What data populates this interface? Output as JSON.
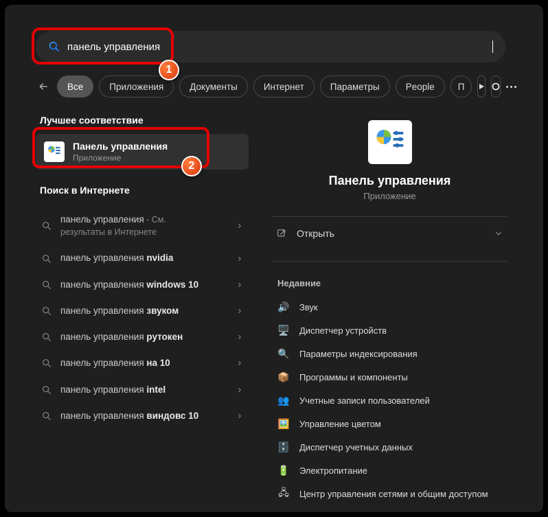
{
  "search": {
    "value": "панель управления"
  },
  "filters": {
    "back_icon": "arrow-left",
    "pills": [
      "Все",
      "Приложения",
      "Документы",
      "Интернет",
      "Параметры",
      "People",
      "П"
    ],
    "active_index": 0,
    "play_icon": "play",
    "circle_icon": "circle",
    "overflow_icon": "more"
  },
  "left": {
    "best_header": "Лучшее соответствие",
    "best": {
      "title": "Панель управления",
      "subtitle": "Приложение"
    },
    "web_header": "Поиск в Интернете",
    "web_items": [
      {
        "prefix": "панель управления",
        "suffix": " - См.",
        "line2": "результаты в Интернете"
      },
      {
        "prefix": "панель управления ",
        "bold": "nvidia"
      },
      {
        "prefix": "панель управления ",
        "bold": "windows 10"
      },
      {
        "prefix": "панель управления ",
        "bold": "звуком"
      },
      {
        "prefix": "панель управления ",
        "bold": "рутокен"
      },
      {
        "prefix": "панель управления ",
        "bold": "на 10"
      },
      {
        "prefix": "панель управления ",
        "bold": "intel"
      },
      {
        "prefix": "панель управления ",
        "bold": "виндовс 10"
      }
    ]
  },
  "right": {
    "title": "Панель управления",
    "subtitle": "Приложение",
    "open": "Открыть",
    "recent_header": "Недавние",
    "recent": [
      {
        "icon": "sound",
        "label": "Звук"
      },
      {
        "icon": "devices",
        "label": "Диспетчер устройств"
      },
      {
        "icon": "index",
        "label": "Параметры индексирования"
      },
      {
        "icon": "programs",
        "label": "Программы и компоненты"
      },
      {
        "icon": "users",
        "label": "Учетные записи пользователей"
      },
      {
        "icon": "color",
        "label": "Управление цветом"
      },
      {
        "icon": "credentials",
        "label": "Диспетчер учетных данных"
      },
      {
        "icon": "power",
        "label": "Электропитание"
      },
      {
        "icon": "network",
        "label": "Центр управления сетями и общим доступом"
      }
    ]
  },
  "badges": {
    "one": "1",
    "two": "2"
  }
}
